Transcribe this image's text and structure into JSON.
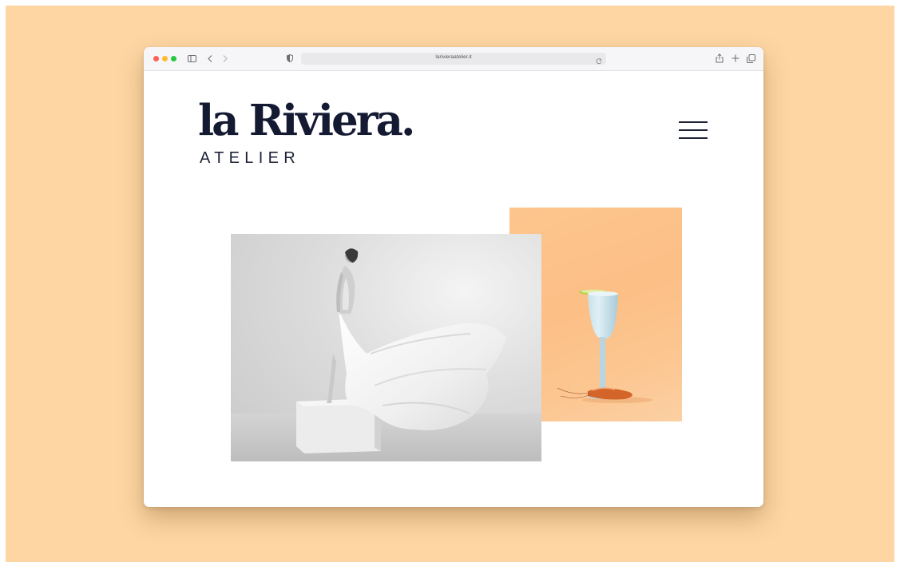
{
  "browser": {
    "url": "larivieraatelier.it",
    "icons": [
      "sidebar-icon",
      "back-icon",
      "forward-icon",
      "shield-icon",
      "reload-icon",
      "share-icon",
      "new-tab-icon",
      "tabs-overview-icon"
    ]
  },
  "site": {
    "logo_main": "la Riviera.",
    "logo_sub": "ATELIER"
  },
  "colors": {
    "backdrop": "#fdd6a3",
    "brand_navy": "#151a33",
    "photo_orange": "#fdc58e"
  },
  "images": [
    {
      "name": "bride-photo",
      "description": "black and white bridal gown"
    },
    {
      "name": "cocktail-photo",
      "description": "pale blue goblet with lime slice and shrimp on orange"
    }
  ]
}
